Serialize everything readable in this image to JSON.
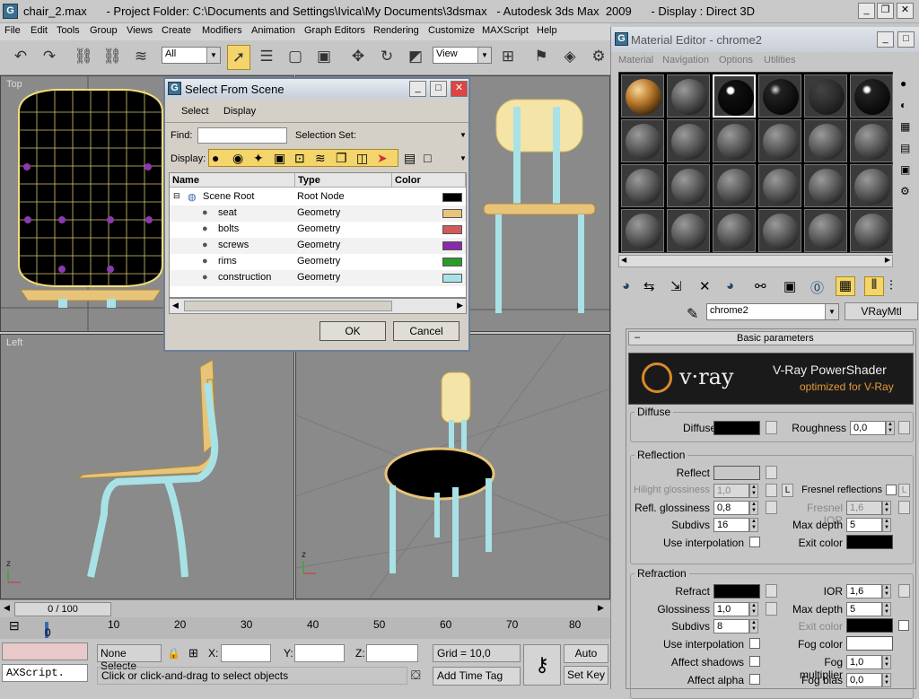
{
  "window": {
    "title": "chair_2.max      - Project Folder: C:\\Documents and Settings\\Ivica\\My Documents\\3dsmax   - Autodesk 3ds Max  2009      - Display : Direct 3D"
  },
  "menu": [
    "File",
    "Edit",
    "Tools",
    "Group",
    "Views",
    "Create",
    "Modifiers",
    "Animation",
    "Graph Editors",
    "Rendering",
    "Customize",
    "MAXScript",
    "Help"
  ],
  "toolbar": {
    "filter": "All",
    "refcoord": "View"
  },
  "viewports": {
    "top": "Top",
    "left": "Left"
  },
  "timeline": {
    "frame": "0 / 100",
    "ticks": [
      "0",
      "10",
      "20",
      "30",
      "40",
      "50",
      "60",
      "70",
      "80"
    ]
  },
  "status": {
    "listener": "AXScript.",
    "selected": "None Selecte",
    "x_label": "X:",
    "y_label": "Y:",
    "z_label": "Z:",
    "grid": "Grid = 10,0",
    "hint": "Click or click-and-drag to select objects",
    "add_time_tag": "Add Time Tag",
    "auto_key": "Auto Key",
    "set_key": "Set Key"
  },
  "dialog": {
    "title": "Select From Scene",
    "menu": [
      "Select",
      "Display"
    ],
    "find_label": "Find:",
    "selset_label": "Selection Set:",
    "display_label": "Display:",
    "columns": [
      "Name",
      "Type",
      "Color"
    ],
    "rows": [
      {
        "name": "Scene Root",
        "type": "Root Node",
        "color": "#000000"
      },
      {
        "name": "seat",
        "type": "Geometry",
        "color": "#e8c47a"
      },
      {
        "name": "bolts",
        "type": "Geometry",
        "color": "#d45a5a"
      },
      {
        "name": "screws",
        "type": "Geometry",
        "color": "#8a2aa8"
      },
      {
        "name": "rims",
        "type": "Geometry",
        "color": "#2a9a2a"
      },
      {
        "name": "construction",
        "type": "Geometry",
        "color": "#a8e2e6"
      }
    ],
    "ok": "OK",
    "cancel": "Cancel"
  },
  "material_editor": {
    "title": "Material Editor - chrome2",
    "menu": [
      "Material",
      "Navigation",
      "Options",
      "Utilities"
    ],
    "material_name": "chrome2",
    "material_type": "VRayMtl",
    "rollout": "Basic parameters",
    "banner_logo": "v·ray",
    "banner_title": "V-Ray PowerShader",
    "banner_sub": "optimized for V-Ray",
    "diffuse_group": "Diffuse",
    "diffuse": "Diffuse",
    "roughness": "Roughness",
    "roughness_val": "0,0",
    "reflection_group": "Reflection",
    "reflect": "Reflect",
    "hilight_gloss": "Hilight glossiness",
    "hilight_gloss_val": "1,0",
    "lock": "L",
    "fresnel": "Fresnel reflections",
    "refl_gloss": "Refl. glossiness",
    "refl_gloss_val": "0,8",
    "fresnel_ior": "Fresnel IOR",
    "fresnel_ior_val": "1,6",
    "subdivs": "Subdivs",
    "subdivs_val": "16",
    "max_depth": "Max depth",
    "max_depth_val": "5",
    "use_interp": "Use interpolation",
    "exit_color": "Exit color",
    "refraction_group": "Refraction",
    "refract": "Refract",
    "ior": "IOR",
    "ior_val": "1,6",
    "glossiness": "Glossiness",
    "glossiness_val": "1,0",
    "rmax_depth": "Max depth",
    "rmax_depth_val": "5",
    "rsubdivs": "Subdivs",
    "rsubdivs_val": "8",
    "rexit_color": "Exit color",
    "ruse_interp": "Use interpolation",
    "fog_color": "Fog color",
    "affect_shadows": "Affect shadows",
    "fog_mult": "Fog multiplier",
    "fog_mult_val": "1,0",
    "affect_alpha": "Affect alpha",
    "fog_bias": "Fog bias",
    "fog_bias_val": "0,0"
  }
}
